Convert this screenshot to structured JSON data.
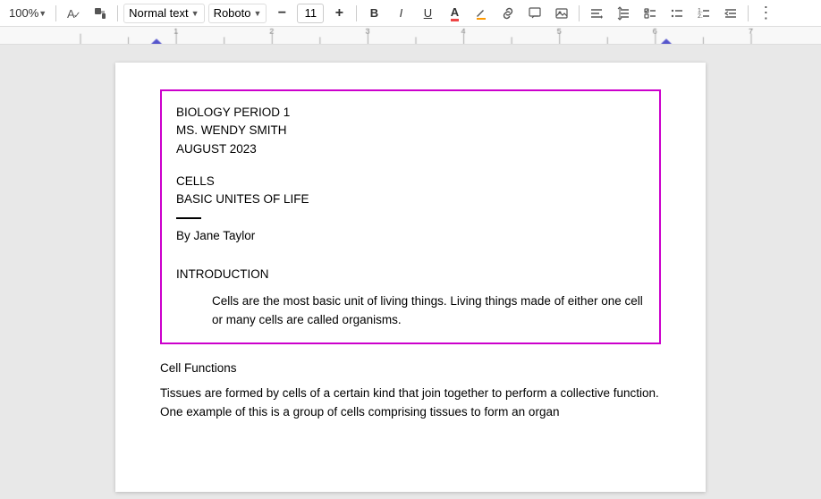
{
  "toolbar": {
    "zoom_label": "100%",
    "style_label": "Normal text",
    "font_label": "Roboto",
    "font_size": "11",
    "bold_label": "B",
    "italic_label": "I",
    "underline_label": "U",
    "more_options_label": "⋮"
  },
  "document": {
    "title_lines": [
      "BIOLOGY PERIOD 1",
      "MS. WENDY SMITH",
      "AUGUST 2023"
    ],
    "subtitle_lines": [
      "CELLS",
      "BASIC UNITES OF LIFE"
    ],
    "author": "By Jane Taylor",
    "introduction_heading": "INTRODUCTION",
    "introduction_text": "Cells are the most basic unit of living things. Living things made of either one cell or many cells are called organisms.",
    "cell_functions_heading": "Cell Functions",
    "body_text": "Tissues are formed by cells of a certain kind that join together to perform a collective function. One example of this is a group of cells comprising tissues to form an organ"
  }
}
